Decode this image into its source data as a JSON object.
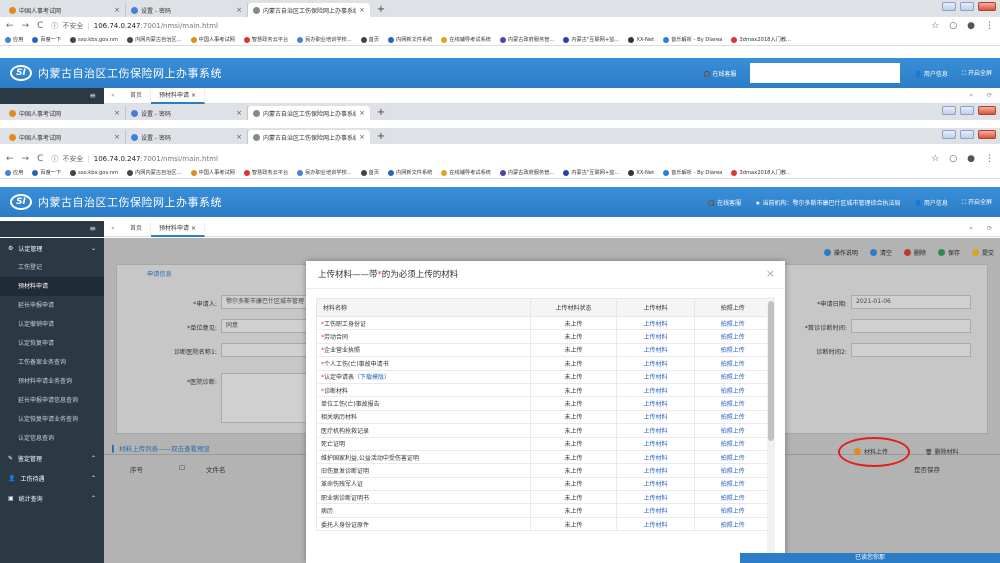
{
  "browser": {
    "tabs": [
      {
        "title": "中国人事考试网",
        "color": "#e28a1c",
        "active": false
      },
      {
        "title": "设置 - 密码",
        "color": "#4a7fd8",
        "active": false
      },
      {
        "title": "内蒙古自治区工伤保险网上办事系统",
        "color": "#777",
        "active": true
      }
    ],
    "new_tab": "+",
    "insecure_label": "不安全",
    "url_host": "106.74.0.247",
    "url_path": ":7001/nmsi/main.html",
    "bookmarks": [
      "应用",
      "百度一下",
      "sso.kbs.gov.nm",
      "内网内蒙古自治区...",
      "中国人事考试网",
      "智慧政务云平台",
      "民办职业培训学校...",
      "首页",
      "内网新文件系统",
      "在线辅导考试系统",
      "内蒙古政府服务管...",
      "内蒙古\"互联网+监...",
      "XX-Net",
      "音乐解析 - By Dlarea",
      "3dmax2018入门教..."
    ]
  },
  "app": {
    "logo_text": "SI",
    "title": "内蒙古自治区工伤保险网上办事系统",
    "header_online": "在线客服",
    "header_agency": "当前机构：鄂尔多斯市康巴什区城市管理综合执法局",
    "header_user": "用户信息",
    "header_fullscreen": "开启全屏",
    "tabs": [
      "首页",
      "预材料申请"
    ],
    "tab_close": "×"
  },
  "sidebar": {
    "groups": [
      {
        "label": "认定管理",
        "items": [
          "工伤登记",
          "预材料申请",
          "延长申报申请",
          "认定撤销申请",
          "认定恢复申请",
          "工伤备案业务查询",
          "预材料申请业务查询",
          "延长申报申请信息查询",
          "认定恢复申请业务查询",
          "认定信息查询"
        ]
      },
      {
        "label": "鉴定管理",
        "items": []
      },
      {
        "label": "工伤待遇",
        "items": []
      },
      {
        "label": "统计查询",
        "items": []
      }
    ],
    "active_item": "预材料申请"
  },
  "toolbar": [
    "操作说明",
    "清空",
    "删除",
    "保存",
    "提交"
  ],
  "form": {
    "section_title": "申请信息",
    "applicant_label": "*申请人:",
    "applicant_value": "鄂尔多斯市康巴什区城市管理",
    "apply_date_label": "*申请日期:",
    "apply_date_value": "2021-01-06",
    "unit_label": "*单位意见:",
    "unit_value": "同意",
    "diag_time_label": "*首诊诊断时间:",
    "diag_hospital_label": "诊断医院名称1:",
    "diag_time2_label": "诊断时间2:",
    "doctor_label": "*医院诊断:"
  },
  "materials_section": {
    "title": "材料上传列表——双击查看预览",
    "col_no": "序号",
    "col_name": "文件名",
    "upload_btn": "材料上传",
    "delete_btn": "删除材料",
    "save_status": "是否保存"
  },
  "modal": {
    "title_prefix": "上传材料——带",
    "title_star": "*",
    "title_suffix": "的为必须上传的材料",
    "close": "×",
    "headers": [
      "材料名称",
      "上传材料状态",
      "上传材料",
      "拍照上传"
    ],
    "rows": [
      {
        "required": true,
        "name": "工伤职工身份证",
        "status": "未上传",
        "upload": "上传材料",
        "photo": "拍照上传"
      },
      {
        "required": true,
        "name": "劳动合同",
        "status": "未上传",
        "upload": "上传材料",
        "photo": "拍照上传"
      },
      {
        "required": true,
        "name": "企业营业执照",
        "status": "未上传",
        "upload": "上传材料",
        "photo": "拍照上传"
      },
      {
        "required": true,
        "name": "个人工伤(亡)事故申请书",
        "status": "未上传",
        "upload": "上传材料",
        "photo": "拍照上传"
      },
      {
        "required": true,
        "name": "认定申请表",
        "template": "（下载模版）",
        "status": "未上传",
        "upload": "上传材料",
        "photo": "拍照上传"
      },
      {
        "required": true,
        "name": "诊断材料",
        "status": "未上传",
        "upload": "上传材料",
        "photo": "拍照上传"
      },
      {
        "required": false,
        "name": "单位工伤(亡)事故报告",
        "status": "未上传",
        "upload": "上传材料",
        "photo": "拍照上传"
      },
      {
        "required": false,
        "name": "相关病历材料",
        "status": "未上传",
        "upload": "上传材料",
        "photo": "拍照上传"
      },
      {
        "required": false,
        "name": "医疗机构抢救记录",
        "status": "未上传",
        "upload": "上传材料",
        "photo": "拍照上传"
      },
      {
        "required": false,
        "name": "死亡证明",
        "status": "未上传",
        "upload": "上传材料",
        "photo": "拍照上传"
      },
      {
        "required": false,
        "name": "维护国家利益,公益活动中受伤害证明",
        "status": "未上传",
        "upload": "上传材料",
        "photo": "拍照上传"
      },
      {
        "required": false,
        "name": "旧伤复发诊断证明",
        "status": "未上传",
        "upload": "上传材料",
        "photo": "拍照上传"
      },
      {
        "required": false,
        "name": "革命伤残军人证",
        "status": "未上传",
        "upload": "上传材料",
        "photo": "拍照上传"
      },
      {
        "required": false,
        "name": "职业病诊断证明书",
        "status": "未上传",
        "upload": "上传材料",
        "photo": "拍照上传"
      },
      {
        "required": false,
        "name": "病历",
        "status": "未上传",
        "upload": "上传材料",
        "photo": "拍照上传"
      },
      {
        "required": false,
        "name": "委托人身份证原件",
        "status": "未上传",
        "upload": "上传材料",
        "photo": "拍照上传"
      }
    ]
  },
  "bottom_bar": "已读您你那"
}
